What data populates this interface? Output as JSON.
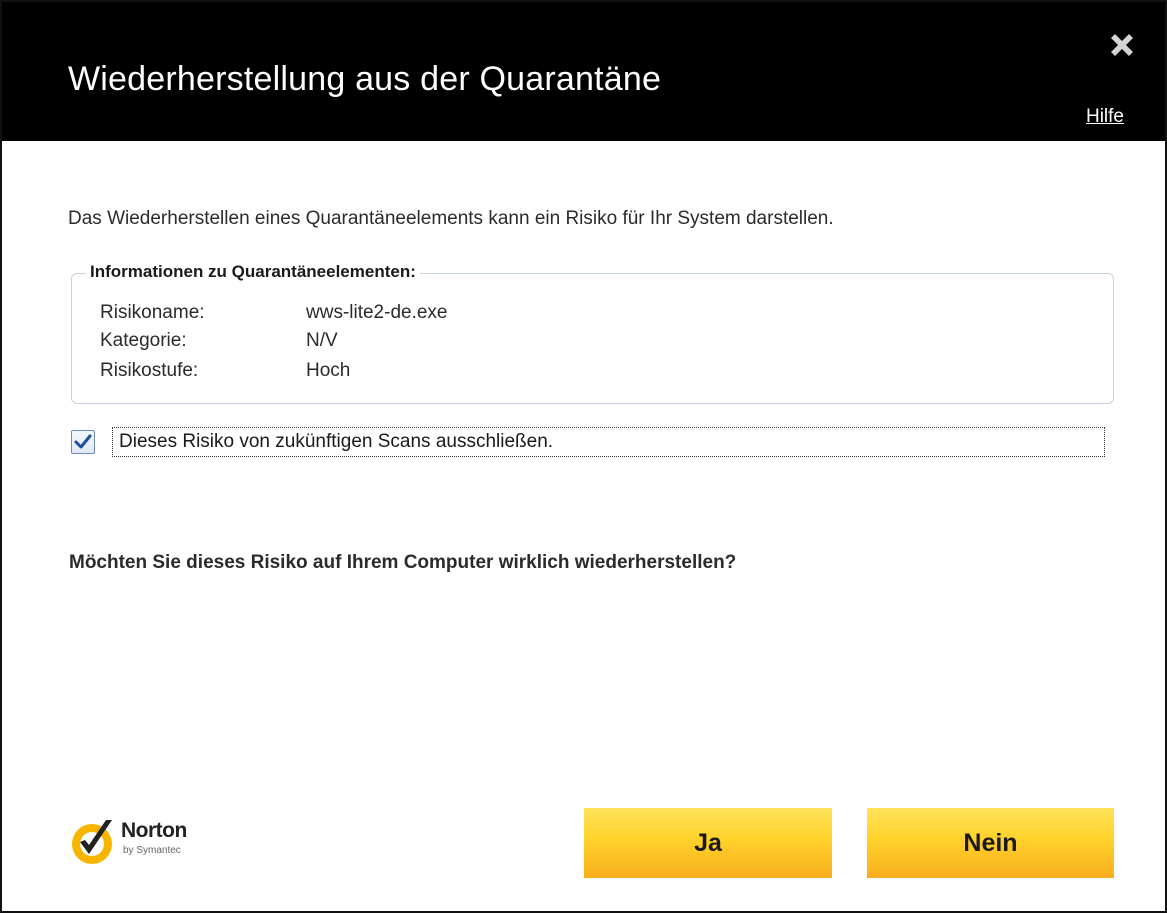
{
  "window": {
    "title": "Wiederherstellung aus der Quarantäne",
    "help_label": "Hilfe",
    "close_icon": "close-icon"
  },
  "intro_text": "Das Wiederherstellen eines Quarantäneelements kann ein Risiko für Ihr System darstellen.",
  "info_box": {
    "legend": "Informationen zu Quarantäneelementen:",
    "rows": [
      {
        "label": "Risikoname:",
        "value": "wws-lite2-de.exe"
      },
      {
        "label": "Kategorie:",
        "value": "N/V"
      },
      {
        "label": "Risikostufe:",
        "value": "Hoch"
      }
    ]
  },
  "exclude_option": {
    "label": "Dieses Risiko von zukünftigen Scans ausschließen.",
    "checked": true
  },
  "question": "Möchten Sie dieses Risiko auf Ihrem Computer wirklich wiederherstellen?",
  "logo": {
    "name": "Norton",
    "tagline": "by Symantec",
    "icon": "norton-checkmark-icon"
  },
  "buttons": {
    "yes_label": "Ja",
    "no_label": "Nein"
  },
  "colors": {
    "titlebar": "#000000",
    "button_top": "#ffe35a",
    "button_bottom": "#f8ad1c",
    "checkmark": "#1f4fa0",
    "logo_yellow": "#f7b500"
  }
}
